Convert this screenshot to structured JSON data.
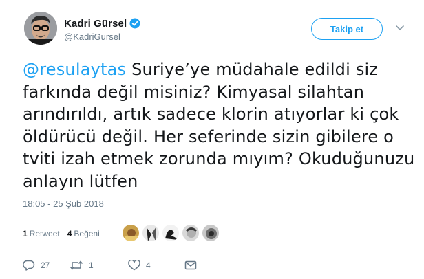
{
  "user": {
    "display_name": "Kadri Gürsel",
    "handle": "@KadriGursel",
    "verified": true
  },
  "follow_button": {
    "label": "Takip et"
  },
  "tweet": {
    "mention": "@resulaytas",
    "text": " Suriye’ye müdahale edildi siz farkında değil misiniz? Kimyasal silahtan arındırıldı, artık sadece klorin atıyorlar ki çok öldürücü değil. Her seferinde sizin gibilere o tviti izah etmek zorunda mıyım? Okuduğunuzu anlayın lütfen",
    "timestamp": "18:05 - 25 Şub 2018"
  },
  "stats": {
    "retweets_count": "1",
    "retweets_label": "Retweet",
    "likes_count": "4",
    "likes_label": "Beğeni"
  },
  "actions": {
    "reply_count": "27",
    "retweet_count": "1",
    "like_count": "4"
  },
  "colors": {
    "accent": "#1da1f2",
    "secondary_text": "#657786",
    "divider": "#e6ecf0"
  }
}
